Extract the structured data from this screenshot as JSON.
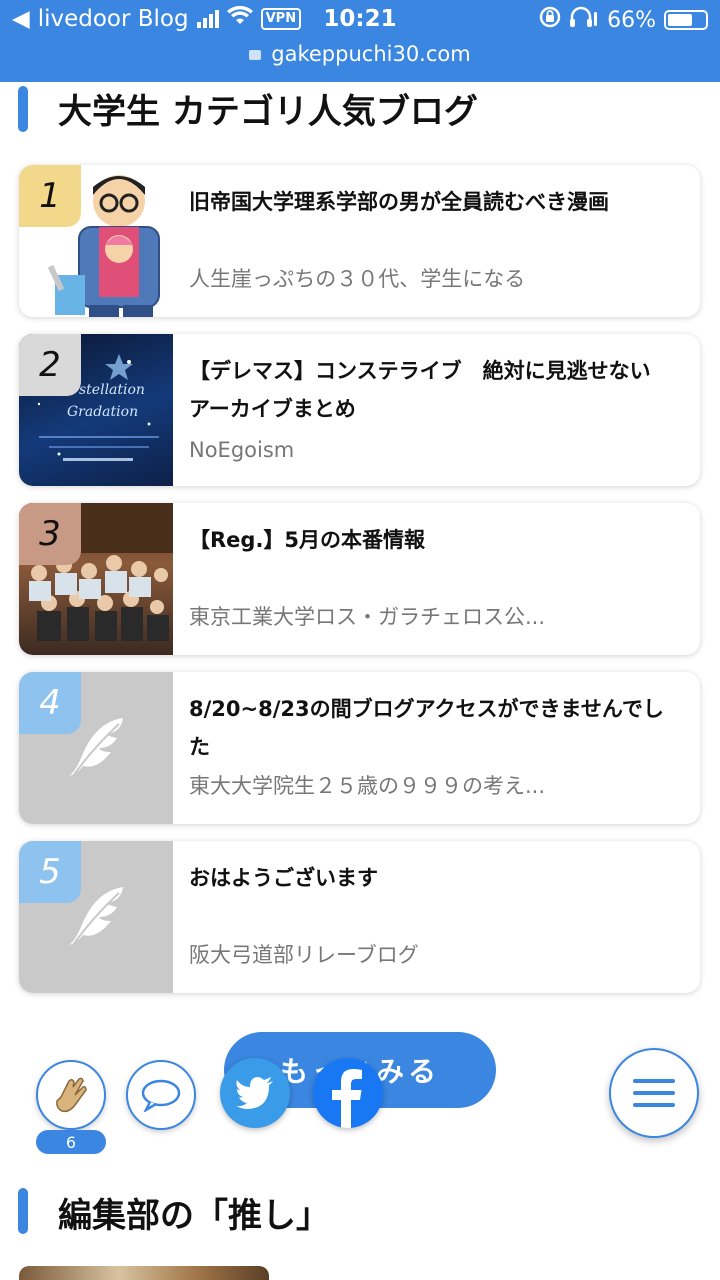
{
  "status_bar": {
    "back_app": "livedoor Blog",
    "vpn": "VPN",
    "time": "10:21",
    "battery_percent": "66%",
    "battery_level": 0.66,
    "url": "gakeppuchi30.com"
  },
  "section1": {
    "title": "大学生 カテゴリ人気ブログ"
  },
  "ranking": [
    {
      "rank": "1",
      "title": "旧帝国大学理系学部の男が全員読むべき漫画",
      "blog": "人生崖っぷちの３０代、学生になる",
      "rank_color": "#f1d88a"
    },
    {
      "rank": "2",
      "title": "【デレマス】コンステライブ　絶対に見逃せないアーカイブまとめ",
      "blog": "NoEgoism",
      "rank_color": "#d9d9d9"
    },
    {
      "rank": "3",
      "title": "【Reg.】5月の本番情報",
      "blog": "東京工業大学ロス・ガラチェロス公...",
      "rank_color": "#c89a85"
    },
    {
      "rank": "4",
      "title": "8/20~8/23の間ブログアクセスができませんでした",
      "blog": "東大大学院生２５歳の９９９の考え...",
      "rank_color": "#8fc3ef"
    },
    {
      "rank": "5",
      "title": "おはようございます",
      "blog": "阪大弓道部リレーブログ",
      "rank_color": "#8fc3ef"
    }
  ],
  "more_button": {
    "label": "もっとみる"
  },
  "float": {
    "clap_count": "6"
  },
  "section2": {
    "title": "編集部の「推し」"
  },
  "colors": {
    "accent": "#3a86e0",
    "twitter": "#3a9be8",
    "facebook": "#1877f2"
  }
}
